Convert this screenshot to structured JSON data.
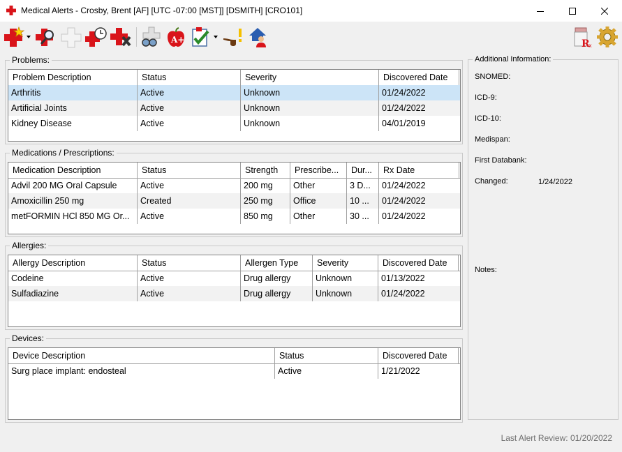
{
  "window": {
    "title": "Medical Alerts - Crosby, Brent [AF] [UTC -07:00 [MST]] [DSMITH] [CRO101]"
  },
  "toolbar": {
    "buttons": [
      "add-alert",
      "search-alert",
      "blank-alert",
      "alert-history",
      "delete-alert",
      "print-preview",
      "health-apple",
      "checklist",
      "pipe-smoking",
      "home-user"
    ],
    "right_buttons": [
      "rx-prescription",
      "settings-gear"
    ]
  },
  "problems": {
    "label": "Problems:",
    "columns": [
      "Problem Description",
      "Status",
      "Severity",
      "Discovered Date"
    ],
    "rows": [
      [
        "Arthritis",
        "Active",
        "Unknown",
        "01/24/2022"
      ],
      [
        "Artificial Joints",
        "Active",
        "Unknown",
        "01/24/2022"
      ],
      [
        "Kidney Disease",
        "Active",
        "Unknown",
        "04/01/2019"
      ]
    ]
  },
  "medications": {
    "label": "Medications / Prescriptions:",
    "columns": [
      "Medication Description",
      "Status",
      "Strength",
      "Prescribe...",
      "Dur...",
      "Rx Date"
    ],
    "rows": [
      [
        "Advil 200 MG Oral Capsule",
        "Active",
        "200 mg",
        "Other",
        "3 D...",
        "01/24/2022"
      ],
      [
        "Amoxicillin 250 mg",
        "Created",
        "250 mg",
        "Office",
        "10 ...",
        "01/24/2022"
      ],
      [
        "metFORMIN HCl 850 MG Or...",
        "Active",
        "850 mg",
        "Other",
        "30 ...",
        "01/24/2022"
      ]
    ]
  },
  "allergies": {
    "label": "Allergies:",
    "columns": [
      "Allergy Description",
      "Status",
      "Allergen Type",
      "Severity",
      "Discovered Date"
    ],
    "rows": [
      [
        "Codeine",
        "Active",
        "Drug allergy",
        "Unknown",
        "01/13/2022"
      ],
      [
        "Sulfadiazine",
        "Active",
        "Drug allergy",
        "Unknown",
        "01/24/2022"
      ]
    ]
  },
  "devices": {
    "label": "Devices:",
    "columns": [
      "Device Description",
      "Status",
      "Discovered Date"
    ],
    "rows": [
      [
        "Surg place implant: endosteal",
        "Active",
        "1/21/2022"
      ]
    ]
  },
  "info": {
    "label": "Additional Information:",
    "snomed": "SNOMED:",
    "icd9": "ICD-9:",
    "icd10": "ICD-10:",
    "medispan": "Medispan:",
    "first_databank": "First Databank:",
    "changed_label": "Changed:",
    "changed_value": "1/24/2022",
    "notes": "Notes:"
  },
  "status": {
    "last_review": "Last Alert Review: 01/20/2022"
  },
  "colors": {
    "selection": "#cce4f7",
    "alt_row": "#f2f2f2",
    "accent_red": "#d9141a"
  }
}
